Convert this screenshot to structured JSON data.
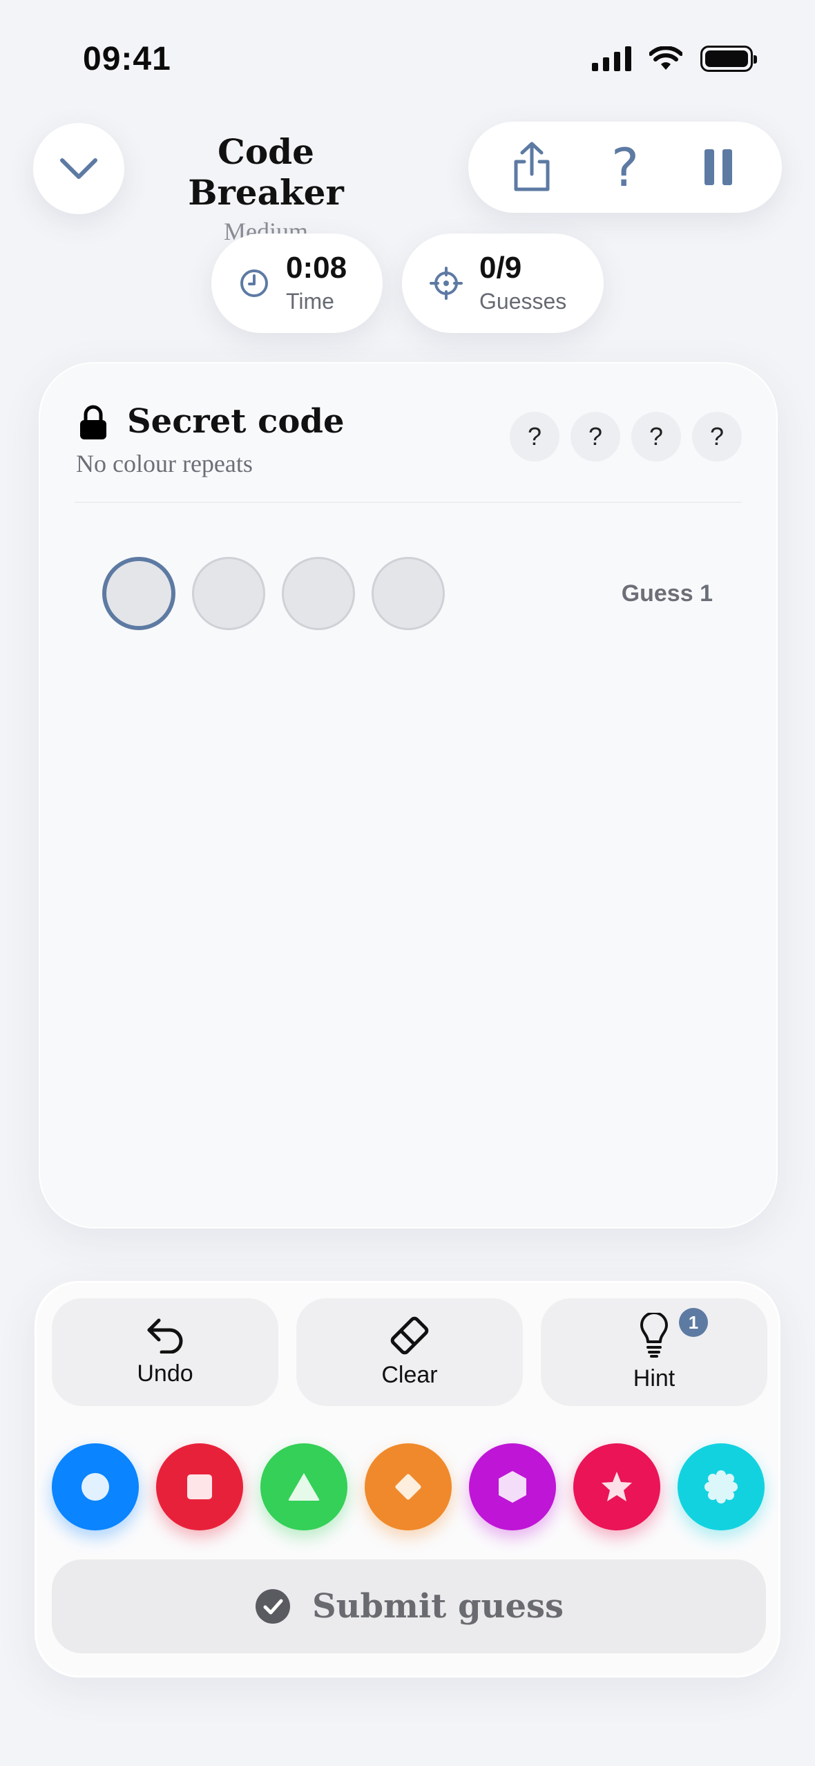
{
  "status_bar": {
    "time": "09:41"
  },
  "header": {
    "title": "Code Breaker",
    "difficulty": "Medium"
  },
  "stats": {
    "time": {
      "value": "0:08",
      "label": "Time"
    },
    "guesses": {
      "value": "0/9",
      "label": "Guesses"
    }
  },
  "secret": {
    "title": "Secret code",
    "subtitle": "No colour repeats",
    "slots": [
      "?",
      "?",
      "?",
      "?"
    ]
  },
  "current_guess": {
    "label": "Guess 1",
    "filled": 0,
    "slots": 4
  },
  "actions": {
    "undo": "Undo",
    "clear": "Clear",
    "hint": "Hint",
    "hint_count": "1"
  },
  "palette": [
    {
      "name": "blue",
      "color": "#0a84ff",
      "shape": "circle"
    },
    {
      "name": "red",
      "color": "#e8213a",
      "shape": "square"
    },
    {
      "name": "green",
      "color": "#34d058",
      "shape": "triangle"
    },
    {
      "name": "orange",
      "color": "#f0892b",
      "shape": "diamond"
    },
    {
      "name": "purple",
      "color": "#bf15d6",
      "shape": "hexagon"
    },
    {
      "name": "pink",
      "color": "#ea1457",
      "shape": "star"
    },
    {
      "name": "cyan",
      "color": "#13d2e0",
      "shape": "flower"
    }
  ],
  "submit": {
    "label": "Submit guess"
  },
  "colors": {
    "accent": "#5d7aa3"
  }
}
